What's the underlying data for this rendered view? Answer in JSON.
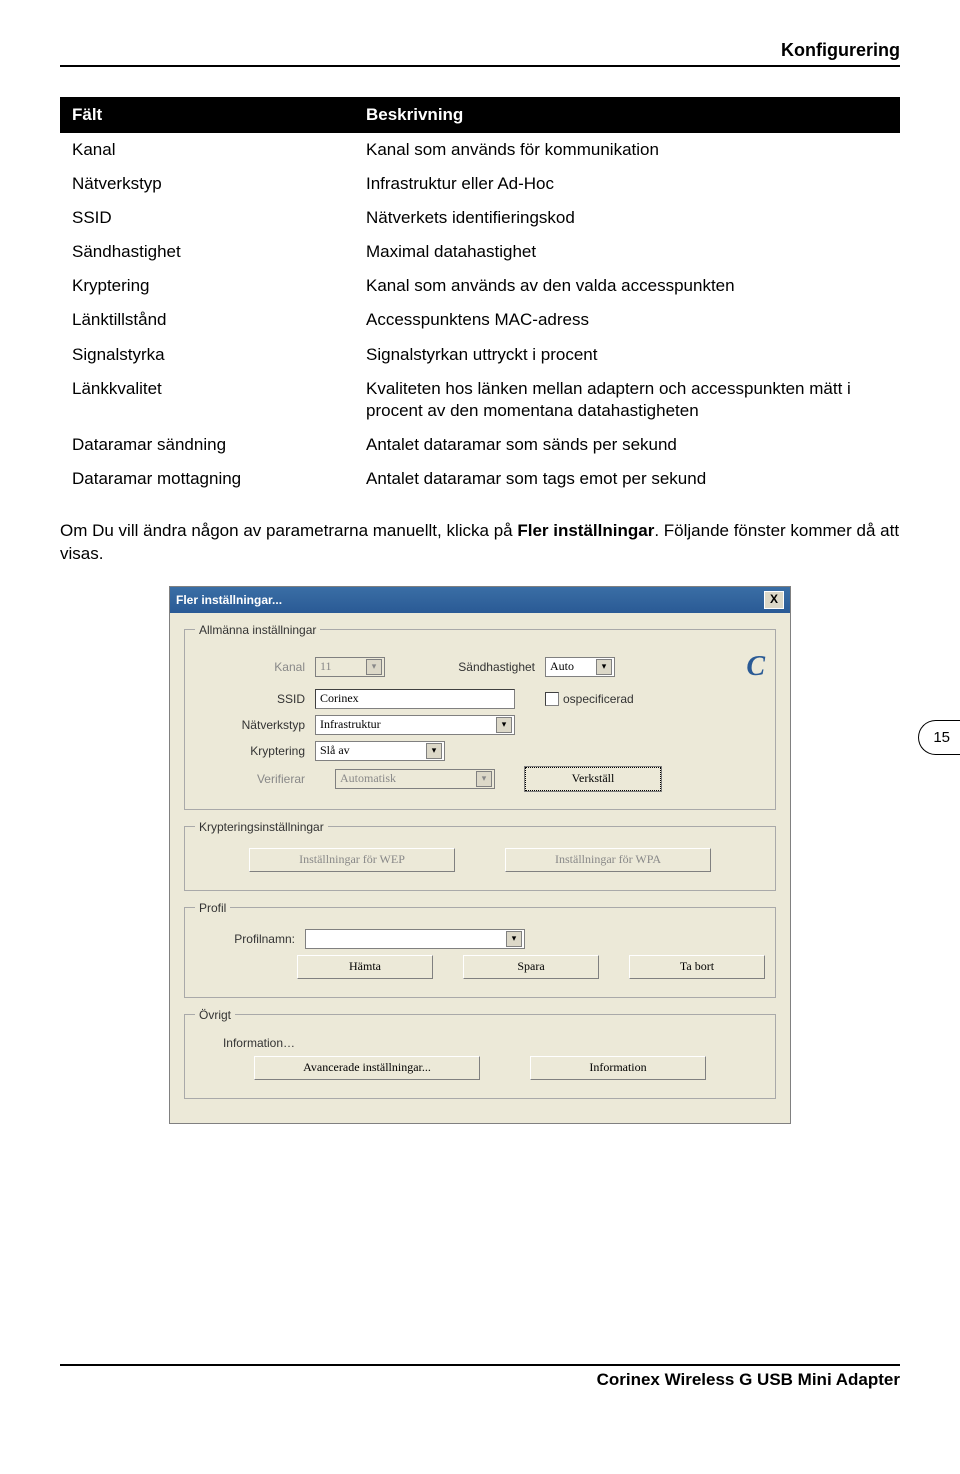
{
  "section_title": "Konfigurering",
  "table": {
    "header": {
      "field": "Fält",
      "desc": "Beskrivning"
    },
    "rows": [
      {
        "field": "Kanal",
        "desc": "Kanal som används för kommunikation"
      },
      {
        "field": "Nätverkstyp",
        "desc": "Infrastruktur eller Ad-Hoc"
      },
      {
        "field": "SSID",
        "desc": "Nätverkets identifieringskod"
      },
      {
        "field": "Sändhastighet",
        "desc": "Maximal datahastighet"
      },
      {
        "field": "Kryptering",
        "desc": "Kanal som används av den valda accesspunkten"
      },
      {
        "field": "Länktillstånd",
        "desc": "Accesspunktens MAC-adress"
      },
      {
        "field": "Signalstyrka",
        "desc": "Signalstyrkan uttryckt i procent"
      },
      {
        "field": "Länkkvalitet",
        "desc": "Kvaliteten hos länken mellan adaptern och accesspunkten mätt i procent av den momentana datahastigheten"
      },
      {
        "field": "Dataramar sändning",
        "desc": "Antalet dataramar som sänds per sekund"
      },
      {
        "field": "Dataramar mottagning",
        "desc": "Antalet dataramar som tags emot per sekund"
      }
    ]
  },
  "body_text": {
    "p1a": "Om Du vill ändra någon av parametrarna manuellt, klicka på ",
    "p1b": "Fler inställningar",
    "p1c": ". Följande fönster kommer då att visas."
  },
  "page_number": "15",
  "dialog": {
    "title": "Fler inställningar...",
    "close": "X",
    "group1": {
      "legend": "Allmänna inställningar",
      "kanal_lbl": "Kanal",
      "kanal_val": "11",
      "sand_lbl": "Sändhastighet",
      "sand_val": "Auto",
      "ssid_lbl": "SSID",
      "ssid_val": "Corinex",
      "ospec_lbl": "ospecificerad",
      "nat_lbl": "Nätverkstyp",
      "nat_val": "Infrastruktur",
      "kryp_lbl": "Kryptering",
      "kryp_val": "Slå av",
      "ver_lbl": "Verifierar",
      "ver_val": "Automatisk",
      "verkstall": "Verkställ"
    },
    "group2": {
      "legend": "Krypteringsinställningar",
      "wep": "Inställningar för WEP",
      "wpa": "Inställningar för WPA"
    },
    "group3": {
      "legend": "Profil",
      "profilnamn_lbl": "Profilnamn:",
      "hamta": "Hämta",
      "spara": "Spara",
      "tabort": "Ta bort"
    },
    "group4": {
      "legend": "Övrigt",
      "info_lbl": "Information…",
      "adv": "Avancerade inställningar...",
      "info_btn": "Information"
    }
  },
  "footer": "Corinex Wireless G USB Mini Adapter"
}
